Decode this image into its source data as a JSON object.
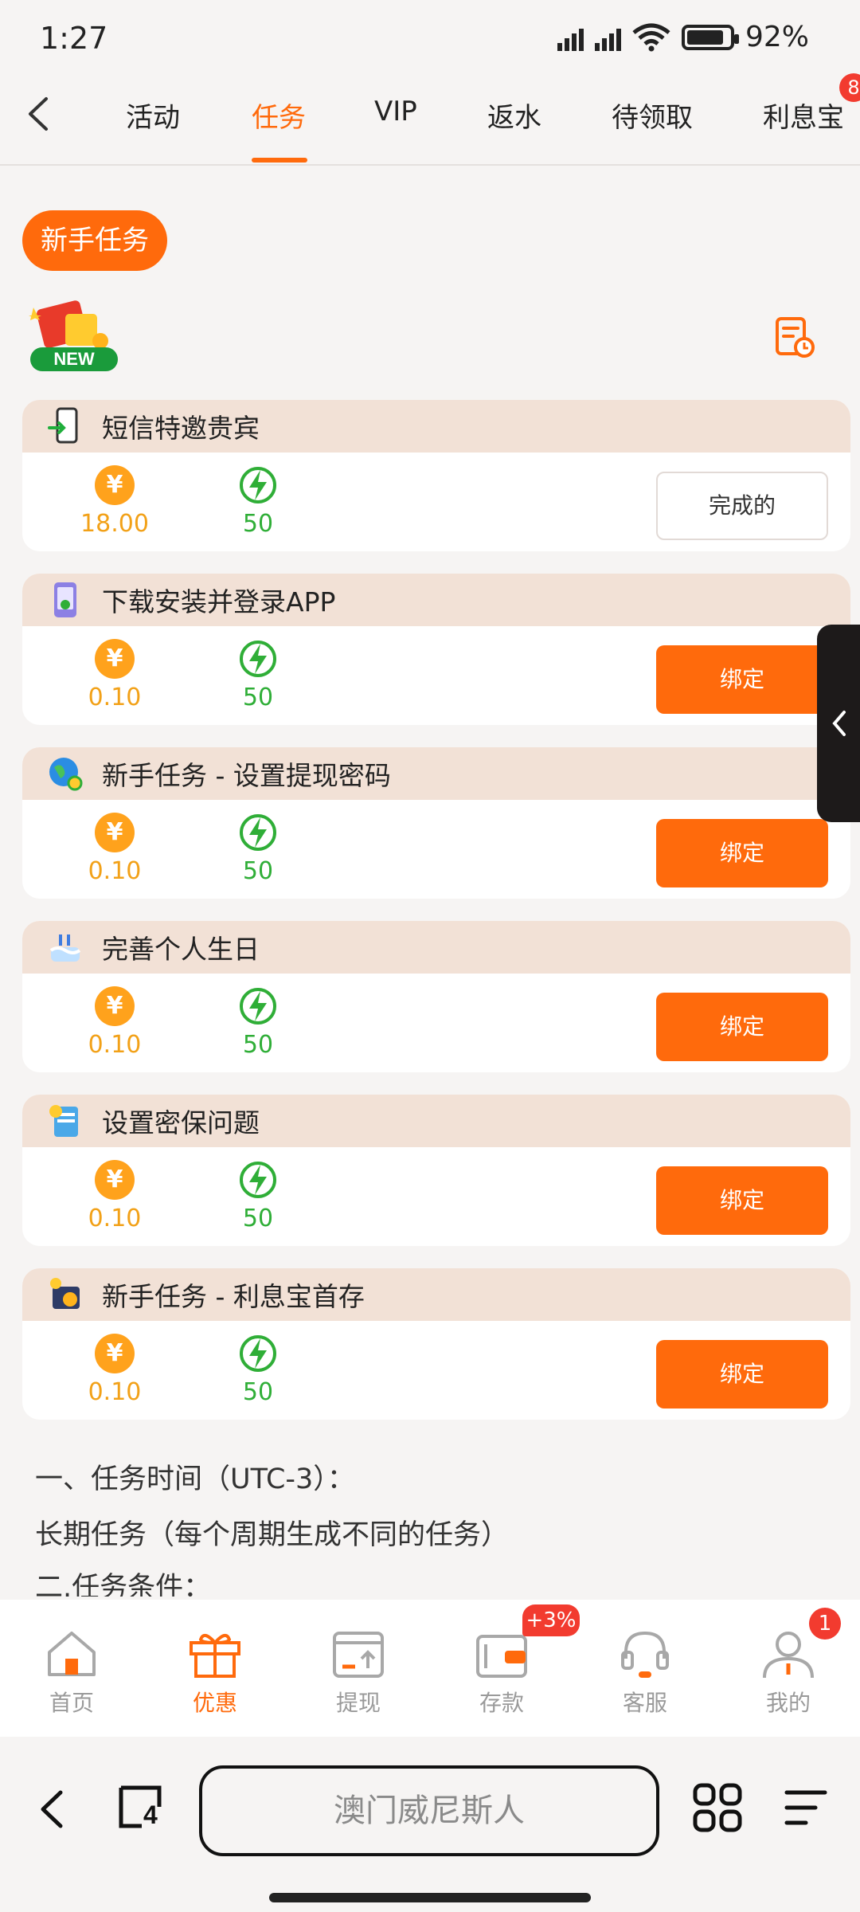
{
  "status_bar": {
    "time": "1:27",
    "battery": "92%"
  },
  "tabs": {
    "items": [
      {
        "label": "活动"
      },
      {
        "label": "任务"
      },
      {
        "label": "VIP"
      },
      {
        "label": "返水"
      },
      {
        "label": "待领取"
      },
      {
        "label": "利息宝"
      }
    ],
    "active_index": 1,
    "badge": "8"
  },
  "section": {
    "label": "新手任务"
  },
  "tasks": [
    {
      "title": "短信特邀贵宾",
      "money": "18.00",
      "points": "50",
      "button": "完成的",
      "completed": true
    },
    {
      "title": "下载安装并登录APP",
      "money": "0.10",
      "points": "50",
      "button": "绑定",
      "completed": false
    },
    {
      "title": "新手任务 - 设置提现密码",
      "money": "0.10",
      "points": "50",
      "button": "绑定",
      "completed": false
    },
    {
      "title": "完善个人生日",
      "money": "0.10",
      "points": "50",
      "button": "绑定",
      "completed": false
    },
    {
      "title": "设置密保问题",
      "money": "0.10",
      "points": "50",
      "button": "绑定",
      "completed": false
    },
    {
      "title": "新手任务 - 利息宝首存",
      "money": "0.10",
      "points": "50",
      "button": "绑定",
      "completed": false
    }
  ],
  "description": {
    "line1": "一、任务时间（UTC-3）：",
    "line2": "长期任务（每个周期生成不同的任务）",
    "line3": "二.任务条件："
  },
  "bottom_nav": {
    "items": [
      {
        "label": "首页"
      },
      {
        "label": "优惠"
      },
      {
        "label": "提现"
      },
      {
        "label": "存款"
      },
      {
        "label": "客服"
      },
      {
        "label": "我的"
      }
    ],
    "deposit_badge": "+3%",
    "mine_badge": "1"
  },
  "browser": {
    "title": "澳门威尼斯人",
    "tab_count": "4"
  },
  "colors": {
    "accent": "#ff6a0c",
    "coin": "#ffa21c",
    "points": "#2fae37",
    "badge": "#f23b2f"
  }
}
